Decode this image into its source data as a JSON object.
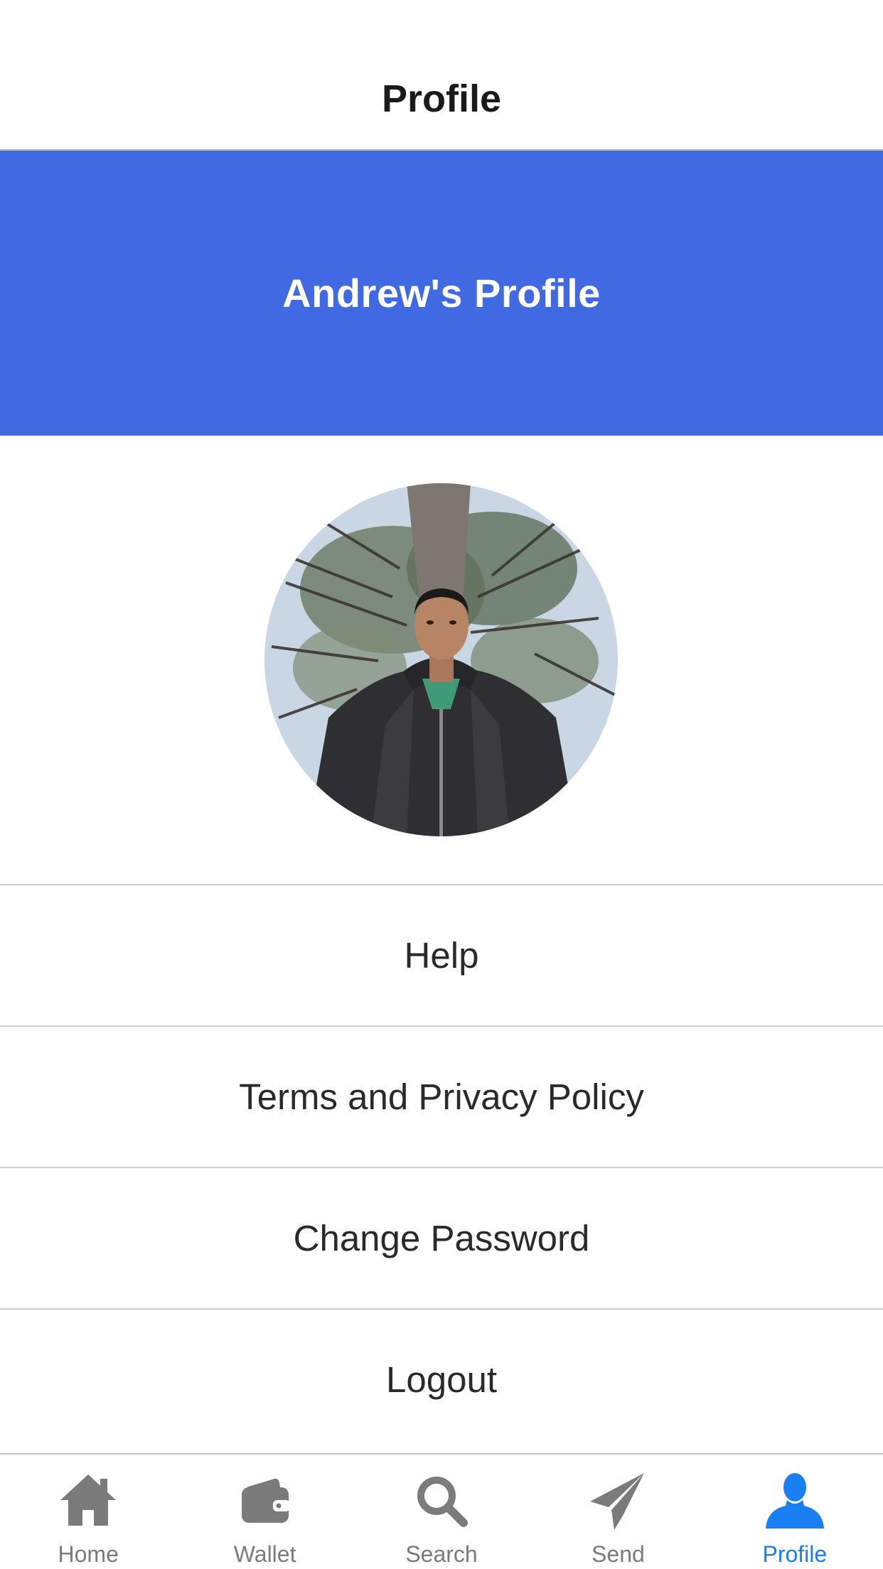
{
  "nav": {
    "title": "Profile"
  },
  "banner": {
    "title": "Andrew's Profile",
    "background": "#4169e1"
  },
  "menu": {
    "items": [
      {
        "label": "Help"
      },
      {
        "label": "Terms and Privacy Policy"
      },
      {
        "label": "Change Password"
      },
      {
        "label": "Logout"
      }
    ]
  },
  "tabbar": {
    "active_color": "#1a7ff2",
    "inactive_color": "#7b7b7b",
    "tabs": [
      {
        "label": "Home",
        "icon": "home-icon",
        "active": false
      },
      {
        "label": "Wallet",
        "icon": "wallet-icon",
        "active": false
      },
      {
        "label": "Search",
        "icon": "search-icon",
        "active": false
      },
      {
        "label": "Send",
        "icon": "send-icon",
        "active": false
      },
      {
        "label": "Profile",
        "icon": "person-icon",
        "active": true
      }
    ]
  }
}
